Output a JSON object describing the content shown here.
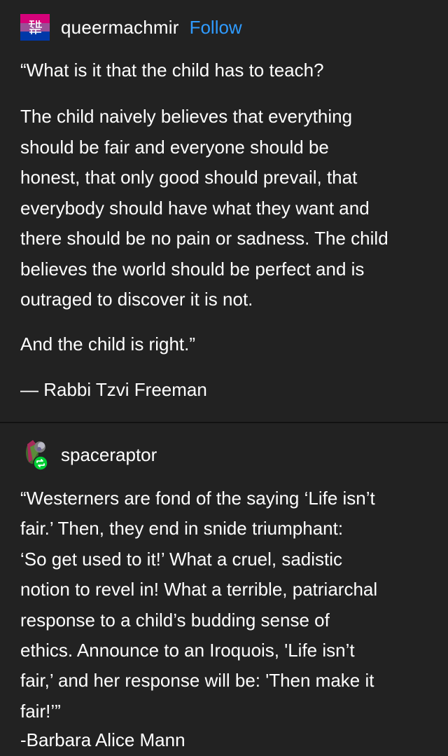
{
  "post1": {
    "username": "queermachmir",
    "follow_label": "Follow",
    "avatar_icon": "bi-flag-glyph-avatar",
    "avatar_colors": [
      "#d6027a",
      "#9b4f96",
      "#0038a8"
    ],
    "paragraph1": "“What is it that the child has to teach?",
    "paragraph2": "The child naively believes that everything\nshould be fair and everyone should be\nhonest, that only good should prevail, that\neverybody should have what they want and\nthere should be no pain or sadness. The child\nbelieves the world should be perfect and is\noutraged to discover it is not.",
    "paragraph3": "And the child is right.”",
    "attribution": "— Rabbi Tzvi Freeman"
  },
  "post2": {
    "username": "spaceraptor",
    "avatar_icon": "dinosaur-avatar",
    "reblog_badge_icon": "reblog-icon",
    "reblog_badge_color": "#00cf35",
    "quote": "“Westerners are fond of the saying ‘Life isn’t\nfair.’ Then, they end in snide triumphant:\n‘So get used to it!’ What a cruel, sadistic\nnotion to revel in! What a terrible, patriarchal\nresponse to a child’s budding sense of\nethics. Announce to an Iroquois, 'Life isn’t\nfair,’ and her response will be: 'Then make it\nfair!’”",
    "attribution": "-Barbara Alice Mann"
  },
  "theme": {
    "background": "#222222",
    "text": "#ffffff",
    "link": "#2f9bff"
  }
}
